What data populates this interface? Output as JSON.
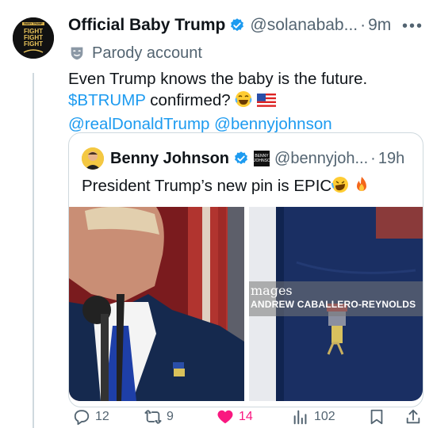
{
  "tweet": {
    "display_name": "Official Baby Trump",
    "handle": "@solanabab...",
    "time": "9m",
    "badge": "Parody account",
    "avatar_text": [
      "BABY TRUMP",
      "FIGHT",
      "FIGHT",
      "FIGHT"
    ],
    "line1": "Even Trump knows the baby is the future.",
    "cashtag": "$BTRUMP",
    "confirmed": " confirmed? ",
    "mention1": "@realDonaldTrump",
    "mention2": "@bennyjohnson"
  },
  "quote": {
    "display_name": "Benny Johnson",
    "handle": "@bennyjoh...",
    "time": "19h",
    "box_text": [
      "BENNY",
      "JOHNSON"
    ],
    "text": "President Trump’s new pin is EPIC",
    "watermark_1": "mages",
    "watermark_2": "ANDREW CABALLERO-REYNOLDS"
  },
  "actions": {
    "replies": "12",
    "reposts": "9",
    "likes": "14",
    "views": "102"
  },
  "colors": {
    "link": "#1d9bf0",
    "like": "#f91880",
    "muted": "#536471",
    "border": "#cfd9de"
  }
}
